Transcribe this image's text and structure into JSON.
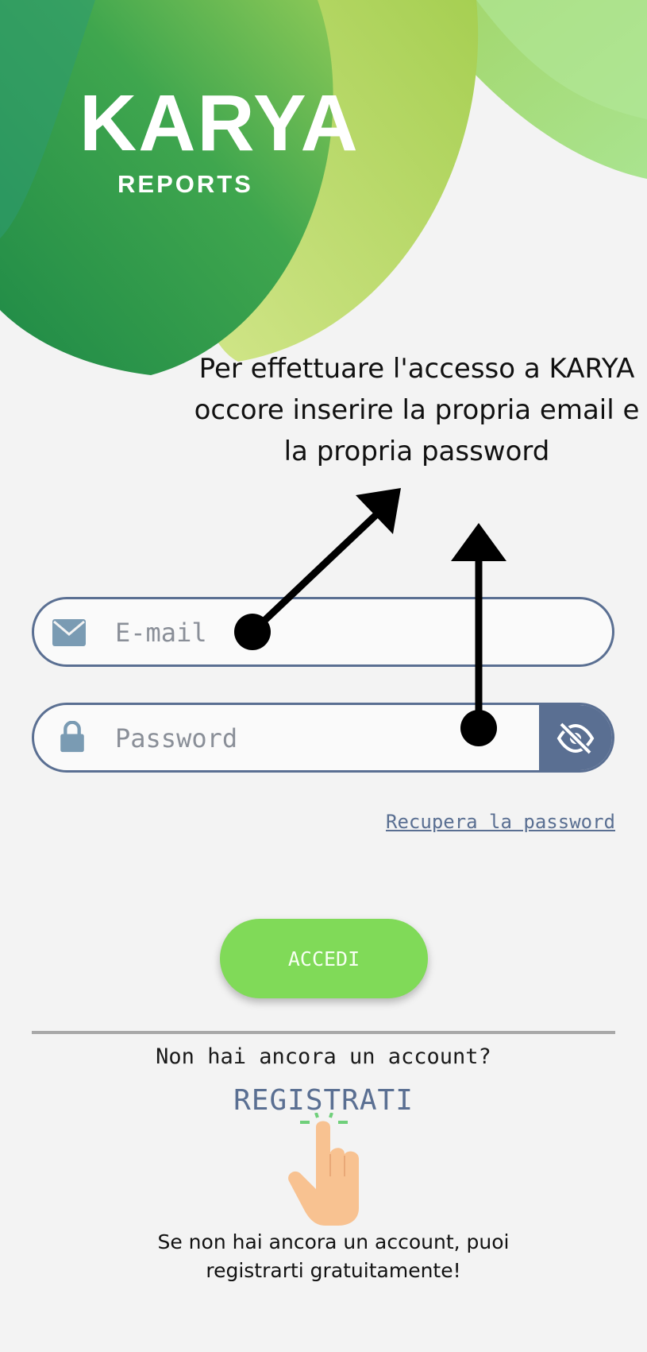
{
  "brand": {
    "name": "KARYA",
    "subtitle": "REPORTS"
  },
  "annotation_top": "Per effettuare l'accesso a KARYA occore inserire la propria email e la propria password",
  "login": {
    "email_placeholder": "E-mail",
    "password_placeholder": "Password",
    "recover_link": "Recupera la password",
    "submit_label": "ACCEDI"
  },
  "signup": {
    "question": "Non hai ancora un account?",
    "register_link": "REGISTRATI"
  },
  "annotation_bottom": "Se non hai ancora un account, puoi registrarti gratuitamente!",
  "colors": {
    "accent_green": "#80da58",
    "field_border": "#5a6f92",
    "background": "#f3f3f3"
  },
  "icons": [
    "envelope-icon",
    "lock-icon",
    "eye-slash-icon",
    "pointing-hand-icon",
    "arrow-icon"
  ]
}
